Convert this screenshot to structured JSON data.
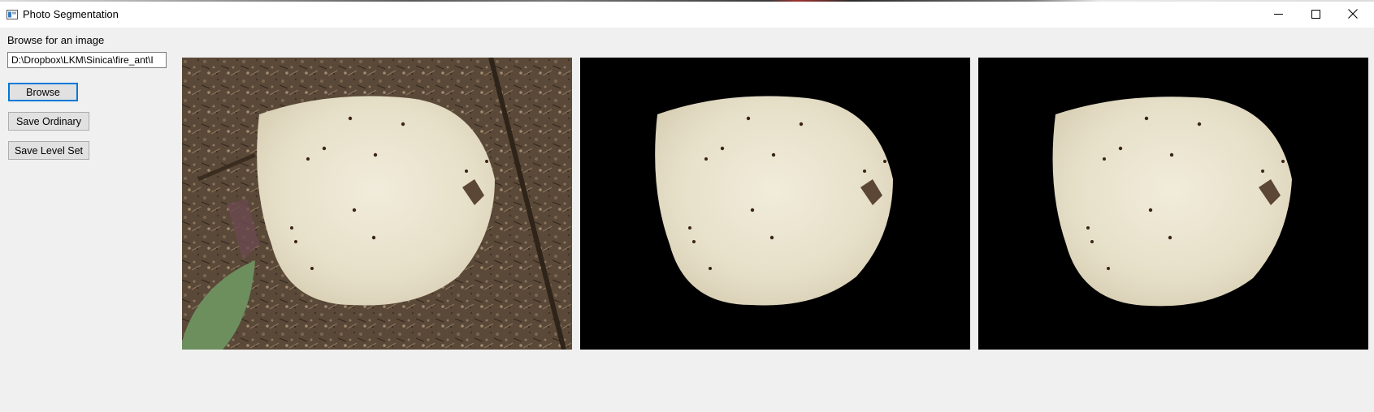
{
  "window": {
    "title": "Photo Segmentation",
    "icon": "app-window-icon",
    "controls": [
      "minimize-icon",
      "maximize-icon",
      "close-icon"
    ]
  },
  "sidebar": {
    "browse_label": "Browse for an image",
    "path_value": "D:\\Dropbox\\LKM\\Sinica\\fire_ant\\I",
    "browse_button": "Browse",
    "save_ordinary_button": "Save Ordinary",
    "save_level_set_button": "Save Level Set"
  },
  "panels": [
    {
      "name": "original",
      "background": "#5b4a3a"
    },
    {
      "name": "segmented-ordinary",
      "background": "#000000"
    },
    {
      "name": "segmented-level-set",
      "background": "#000000"
    }
  ],
  "colors": {
    "focus_blue": "#0078d7",
    "window_bg": "#f0f0f0",
    "cracker": "#e9e3cf"
  }
}
